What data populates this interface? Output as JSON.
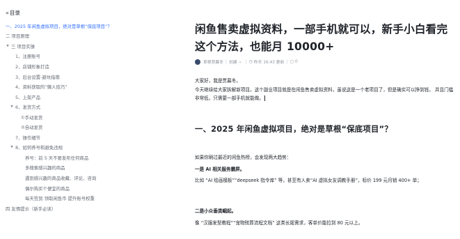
{
  "toc": {
    "header": "目录",
    "items": [
      {
        "text": "一、2025 年闲鱼虚拟项目，绝对是草根“保底项目”？",
        "level": "lvl0 nocaret active",
        "caret": ""
      },
      {
        "text": "二 项目原理",
        "level": "lvl0 nocaret",
        "caret": ""
      },
      {
        "text": "三 项目实操",
        "level": "lvl0",
        "caret": "▼"
      },
      {
        "text": "1、注册账号",
        "level": "lvl1",
        "caret": ""
      },
      {
        "text": "2、店铺形象打造",
        "level": "lvl1",
        "caret": ""
      },
      {
        "text": "3、后台设置-避坑指南",
        "level": "lvl1",
        "caret": ""
      },
      {
        "text": "4、资料获取的“懒人技巧”",
        "level": "lvl1",
        "caret": ""
      },
      {
        "text": "5、上架产品",
        "level": "lvl1",
        "caret": ""
      },
      {
        "text": "6、发货方式",
        "level": "lvl1 withcaret",
        "caret": "▼"
      },
      {
        "text": "①手动发货",
        "level": "lvl1s",
        "caret": ""
      },
      {
        "text": "②自动发货",
        "level": "lvl1s",
        "caret": ""
      },
      {
        "text": "7、操作细节",
        "level": "lvl1",
        "caret": ""
      },
      {
        "text": "8、如何养号和避免违规",
        "level": "lvl1 withcaret",
        "caret": "▼"
      },
      {
        "text": "养号：前 5 天不要发布任何商品",
        "level": "lvl2",
        "caret": ""
      },
      {
        "text": "多搜索感兴趣的商品",
        "level": "lvl2",
        "caret": ""
      },
      {
        "text": "遇到感兴趣的商品收藏、评论、咨询",
        "level": "lvl2",
        "caret": ""
      },
      {
        "text": "偶尔购买个便宜的商品",
        "level": "lvl2",
        "caret": ""
      },
      {
        "text": "每天签到 领取闲鱼币 提升账号权重",
        "level": "lvl2",
        "caret": ""
      },
      {
        "text": "四 友情提示（新手必读）",
        "level": "lvl0 nocaret",
        "caret": ""
      }
    ]
  },
  "article": {
    "title": "闲鱼售卖虚拟资料，一部手机就可以，新手小白看完这个方法，也能月 10000+",
    "author": "草根贾暮冬",
    "followed": "创建",
    "updated": "昨天 16:43 更新",
    "comments": "0",
    "p1": "大家好，我是贾暮冬。",
    "p2": "今天继续给大家拆解新项目。这个副业项目就是在闲鱼售卖虚拟资料，虽说这是一个老项目了，但是确实可以挣到钱， 并且门槛非常低，只需要一部手机就能做。",
    "h2": "一、2025 年闲鱼虚拟项目，绝对是草根“保底项目”？",
    "p3": "如果你刷过最近的闲鱼热榜，会发现两大趋势：",
    "p4": "一是 AI 相关服务霸屏。",
    "p5": "比如 “AI 绘画模板”“deepseek 指令库” 等，甚至有人卖“AI 虚拟女友调教手册”，标价 199 元月销 400+ 单；",
    "p6": "二是小众垂类崛起。",
    "p7": "像 “汉服发型教程”“宠物殡葬流程文档” 这类长尾需求，客单价能拉到 80 元以上。"
  }
}
